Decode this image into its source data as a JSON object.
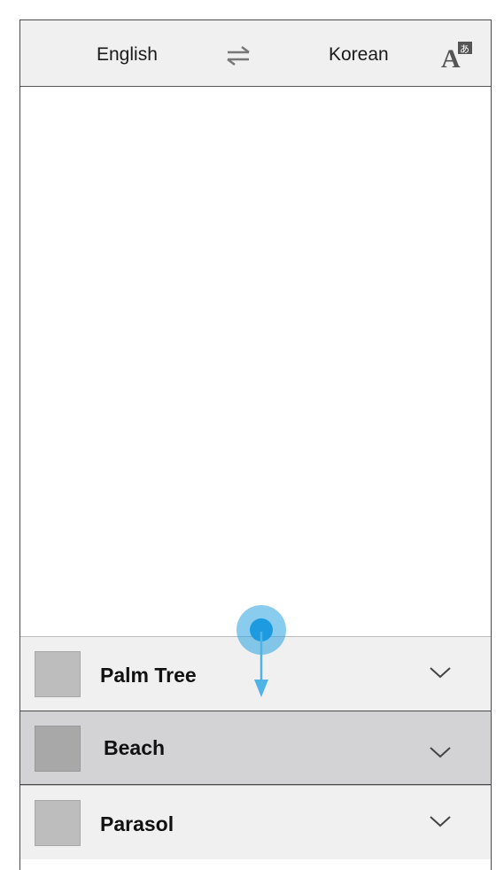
{
  "header": {
    "source_language": "English",
    "target_language": "Korean",
    "swap_icon": "swap-arrows-icon",
    "translate_icon": "translate-A-icon"
  },
  "list": {
    "items": [
      {
        "label": "Palm Tree",
        "selected": false
      },
      {
        "label": "Beach",
        "selected": true
      },
      {
        "label": "Parasol",
        "selected": false
      }
    ]
  },
  "gesture": {
    "type": "drag-down",
    "color": "#2aa3e0"
  },
  "colors": {
    "bar_bg": "#f0f0f0",
    "selected_row_bg": "#d3d3d5",
    "gesture_blue": "#2aa3e0"
  }
}
